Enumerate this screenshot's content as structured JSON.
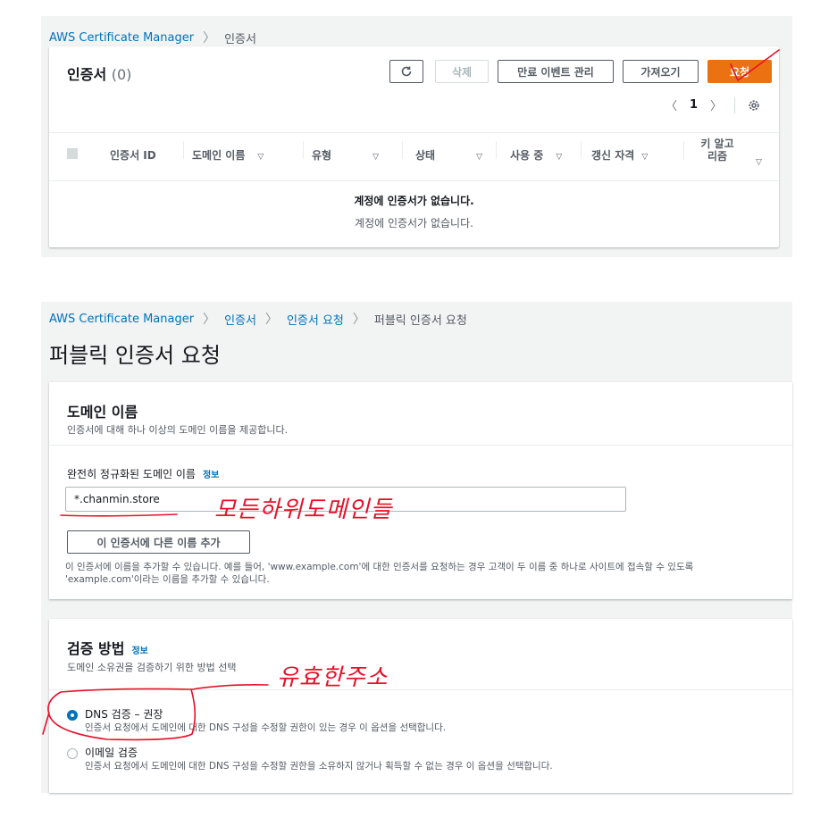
{
  "top": {
    "breadcrumb": {
      "root": "AWS Certificate Manager",
      "current": "인증서"
    },
    "title": "인증서",
    "count": "(0)",
    "buttons": {
      "delete": "삭제",
      "manage_expiry": "만료 이벤트 관리",
      "import": "가져오기",
      "request": "요청"
    },
    "pagination": {
      "prev": "〈",
      "page": "1",
      "next": "〉"
    },
    "columns": [
      "인증서 ID",
      "도메인 이름",
      "유형",
      "상태",
      "사용 중",
      "갱신 자격",
      "키 알고리즘"
    ],
    "empty_title": "계정에 인증서가 없습니다.",
    "empty_desc": "계정에 인증서가 없습니다."
  },
  "bottom": {
    "breadcrumb": {
      "root": "AWS Certificate Manager",
      "item1": "인증서",
      "item2": "인증서 요청",
      "current": "퍼블릭 인증서 요청"
    },
    "page_title": "퍼블릭 인증서 요청",
    "domain": {
      "title": "도메인 이름",
      "desc": "인증서에 대해 하나 이상의 도메인 이름을 제공합니다.",
      "field_label": "완전히 정규화된 도메인 이름",
      "info": "정보",
      "value": "*.chanmin.store",
      "add_button": "이 인증서에 다른 이름 추가",
      "help1": "이 인증서에 이름을 추가할 수 있습니다. 예를 들어, 'www.example.com'에 대한 인증서를 요청하는 경우 고객이 두 이름 중 하나로 사이트에 접속할 수 있도록",
      "help2": "'example.com'이라는 이름을 추가할 수 있습니다."
    },
    "validation": {
      "title": "검증 방법",
      "info": "정보",
      "desc": "도메인 소유권을 검증하기 위한 방법 선택",
      "dns_label": "DNS 검증 – 권장",
      "dns_desc": "인증서 요청에서 도메인에 대한 DNS 구성을 수정할 권한이 있는 경우 이 옵션을 선택합니다.",
      "email_label": "이메일 검증",
      "email_desc": "인증서 요청에서 도메인에 대한 DNS 구성을 수정할 권한을 소유하지 않거나 획득할 수 없는 경우 이 옵션을 선택합니다."
    }
  },
  "annotations": {
    "note1": "모든하위도메인들",
    "note2": "유효한주소"
  },
  "colors": {
    "accent": "#ec7211",
    "link": "#0073bb",
    "ink": "#e8102a"
  }
}
